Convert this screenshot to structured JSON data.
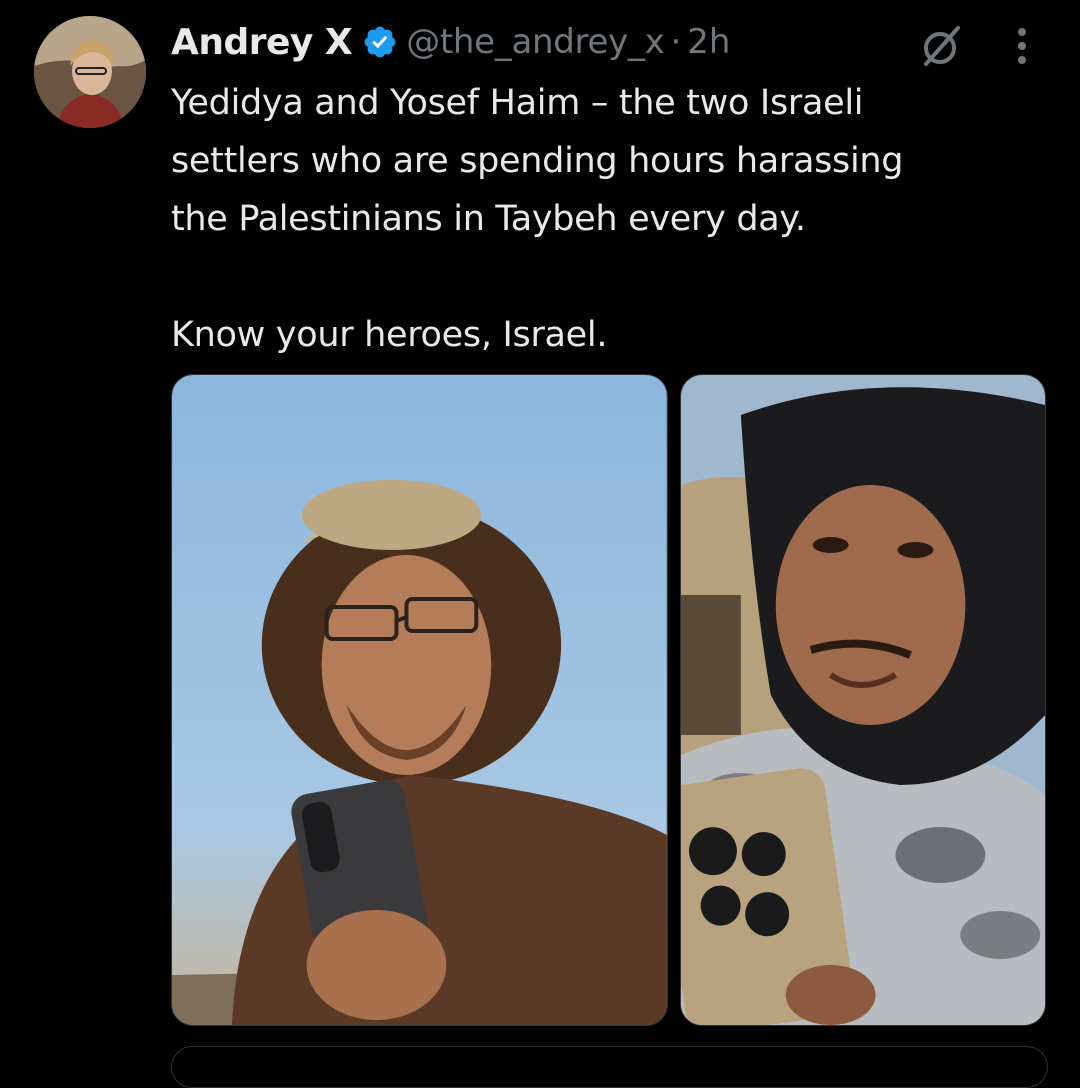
{
  "tweet": {
    "author": {
      "display_name": "Andrey X",
      "handle": "@the_andrey_x",
      "verified": true,
      "avatar": "user-avatar-photo"
    },
    "separator": "·",
    "time": "2h",
    "text_lines": [
      "Yedidya and Yosef Haim – the two Israeli",
      "settlers who are spending hours harassing",
      "the Palestinians in Taybeh every day.",
      "Know your heroes, Israel."
    ],
    "media": [
      {
        "name": "photo-1"
      },
      {
        "name": "photo-2"
      }
    ]
  },
  "icons": {
    "verified": "verified-badge-icon",
    "grok": "grok-icon",
    "more": "more-options-icon"
  },
  "colors": {
    "background": "#000000",
    "text": "#e7e9ea",
    "secondary_text": "#71767b",
    "verified_blue": "#1d9bf0",
    "border": "#2f3336"
  }
}
